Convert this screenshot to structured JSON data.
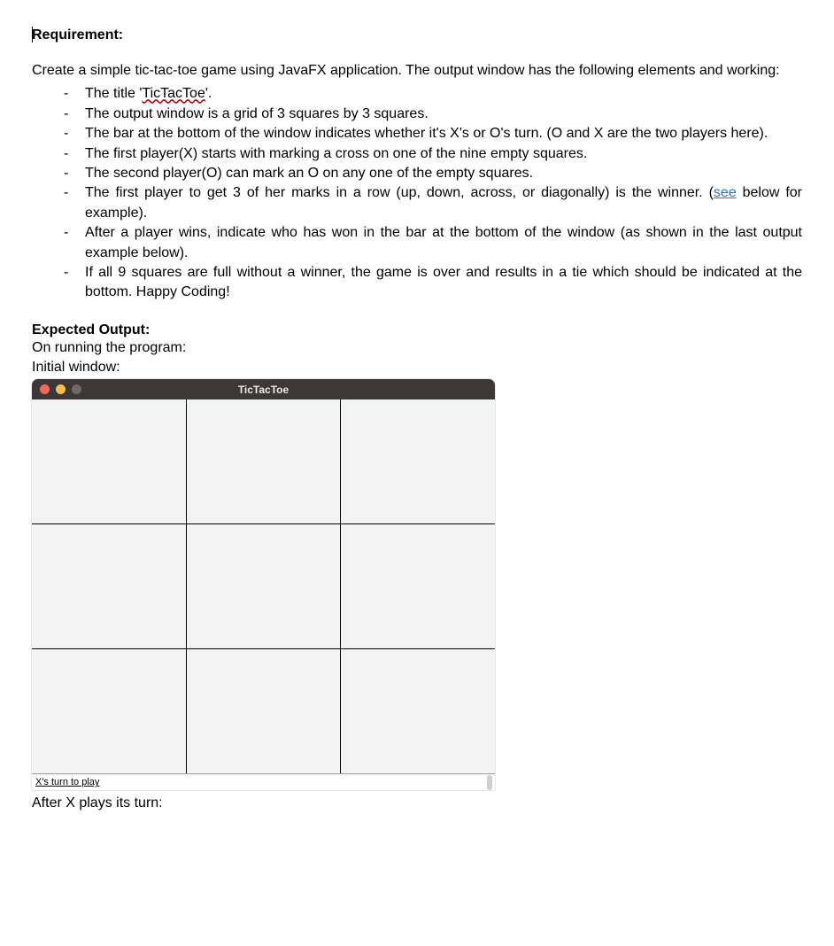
{
  "headings": {
    "requirement": "Requirement:",
    "expected_output": "Expected Output:"
  },
  "intro": "Create a simple tic-tac-toe game using JavaFX application. The output window has the following elements and working:",
  "bullets": [
    {
      "pre": "The title '",
      "mid": "TicTacToe",
      "post": "'.",
      "squiggle": true
    },
    {
      "text": "The output window is a grid of 3 squares by 3 squares."
    },
    {
      "text": "The bar at the bottom of the window indicates whether it's X's or O's turn. (O and X are the two players here).",
      "justify": true
    },
    {
      "text": "The first player(X) starts with marking a cross on one of the nine empty squares."
    },
    {
      "text": "The second player(O) can mark an O on any one of the empty squares."
    },
    {
      "pre": "The first player to get 3 of her marks in a row (up, down, across, or diagonally) is the winner. (",
      "mid": "see",
      "post": " below for example).",
      "see": true,
      "justify": true
    },
    {
      "text": "After a player wins, indicate who has won in the bar at the bottom of the window (as shown in the last output example below).",
      "justify": true
    },
    {
      "text": "If all 9 squares are full without a winner, the game is over and results in a tie which should be indicated at the bottom. Happy Coding!",
      "justify": true
    }
  ],
  "expected_lines": {
    "on_running": "On running the program:",
    "initial_window": "Initial window:",
    "after_x": "After X plays its turn:"
  },
  "window": {
    "title": "TicTacToe",
    "status": "X's turn to play"
  }
}
